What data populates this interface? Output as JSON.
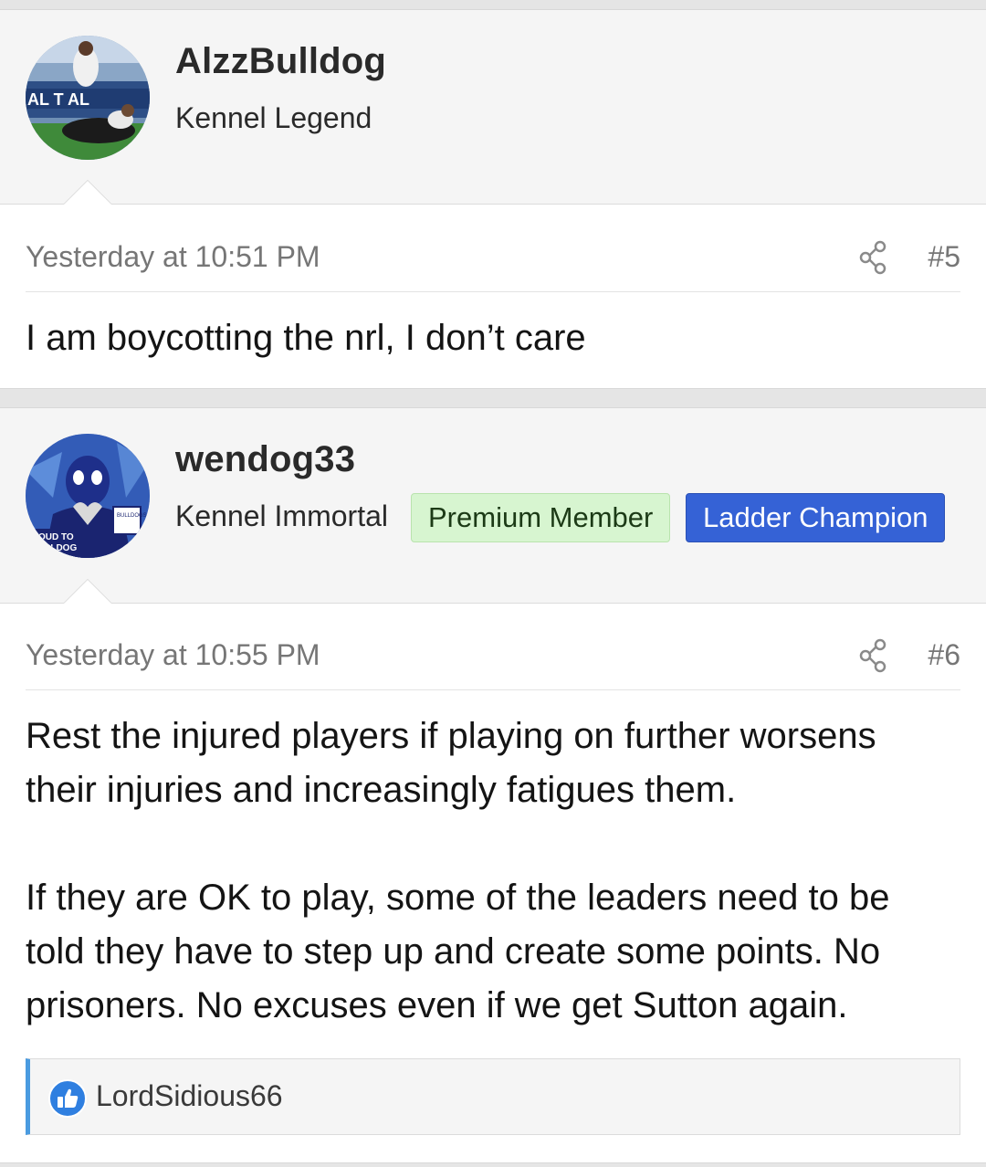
{
  "posts": [
    {
      "username": "AlzzBulldog",
      "user_title": "Kennel Legend",
      "badges": [],
      "date": "Yesterday at 10:51 PM",
      "post_number": "#5",
      "message": [
        "I am boycotting the nrl, I don’t care"
      ],
      "avatar": "rugby-league-player-photo"
    },
    {
      "username": "wendog33",
      "user_title": "Kennel Immortal",
      "badges": [
        "Premium Member",
        "Ladder Champion"
      ],
      "date": "Yesterday at 10:55 PM",
      "post_number": "#6",
      "message": [
        "Rest the injured players if playing on further worsens their injuries and increasingly fatigues them.",
        "If they are OK to play, some of the leaders need to be told they have to step up and create some points. No prisoners. No excuses even if we get Sutton again."
      ],
      "avatar": "deadpool-bulldogs-heart-hands",
      "avatar_text": "OUD TO\nULLDOG",
      "reactions": {
        "icon": "thumbs-up-icon",
        "users": "LordSidious66"
      }
    }
  ],
  "colors": {
    "background": "#e5e5e5",
    "user_block": "#f5f5f5",
    "muted_text": "#767676",
    "premium_badge_bg": "#d7f5d0",
    "ladder_badge_bg": "#3562d6",
    "reaction_accent": "#4a9be0"
  }
}
